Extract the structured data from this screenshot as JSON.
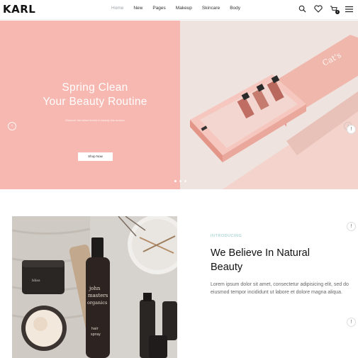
{
  "header": {
    "logo": "KARL",
    "nav": [
      "Home",
      "New",
      "Pages",
      "Makeup",
      "Skincare",
      "Body"
    ],
    "active_nav": "Home",
    "icons": [
      "search-icon",
      "heart-icon",
      "cart-icon",
      "menu-icon"
    ],
    "cart_count": "0"
  },
  "hero": {
    "title_line1": "Spring Clean",
    "title_line2": "Your Beauty Routine",
    "subtitle": "Discover the latest trends in beauty this season",
    "button_label": "Shop Now",
    "left_bg": "#f7b8b1",
    "box_brand": "Cat's",
    "slide_count": 3,
    "active_slide": 1
  },
  "feature": {
    "kicker": "INTRODUCING",
    "title_line1": "We Believe In Natural",
    "title_line2": "Beauty",
    "body": "Lorem ipsum dolor sit amet, consectetur adipisicing elit, sed do eiusmod tempor incididunt ut labore et dolore magna aliqua.",
    "bottle_brand_line1": "john",
    "bottle_brand_line2": "masters",
    "bottle_brand_line3": "organics",
    "bottle_product_line1": "hair",
    "bottle_product_line2": "spray",
    "jar_label": "bliss"
  },
  "colors": {
    "accent": "#8ec9c6",
    "hero_pink": "#f7b8b1",
    "box_pink": "#efa79c"
  }
}
